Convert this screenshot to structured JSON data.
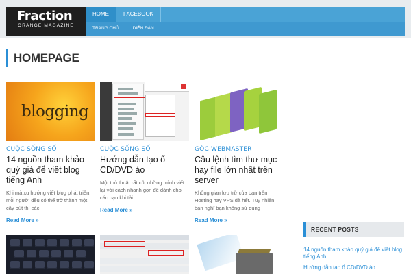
{
  "logo": {
    "title": "Fraction",
    "subtitle": "ORANGE MAGAZINE"
  },
  "nav": {
    "primary": [
      "HOME",
      "FACEBOOK"
    ],
    "secondary": [
      "TRANG CHỦ",
      "DIỄN ĐÀN"
    ],
    "active_index": 0
  },
  "page": {
    "heading": "HOMEPAGE"
  },
  "posts": [
    {
      "category": "Cuộc sống số",
      "title": "14 nguồn tham khảo quý giá để viết blog tiếng Anh",
      "excerpt": "Khi mà xu hướng viết blog phát triển, mỗi người đều có thể trở thành một cây bút thì các",
      "read_more": "Read More »",
      "thumb_text": "blogging"
    },
    {
      "category": "Cuộc sống số",
      "title": "Hướng dẫn tạo ổ CD/DVD ảo",
      "excerpt": "Một thủ thuật rất cũ, những mình viết lại với cách nhanh gọn để dành cho các bạn khi tải",
      "read_more": "Read More »"
    },
    {
      "category": "Góc Webmaster",
      "title": "Câu lệnh tìm thư mục hay file lớn nhất trên server",
      "excerpt": "Không gian lưu trữ của bạn trên Hosting hay VPS đã hết. Tuy nhiên bạn nghĩ bạn không sử dụng",
      "read_more": "Read More »"
    }
  ],
  "sidebar": {
    "recent_title": "RECENT POSTS",
    "recent_posts": [
      "14 nguồn tham khảo quý giá để viết blog tiếng Anh",
      "Hướng dẫn tạo ổ CD/DVD ảo"
    ]
  },
  "colors": {
    "accent": "#2b8fd6",
    "nav": "#4aa3d6",
    "logo_bg": "#1f1f1f"
  }
}
